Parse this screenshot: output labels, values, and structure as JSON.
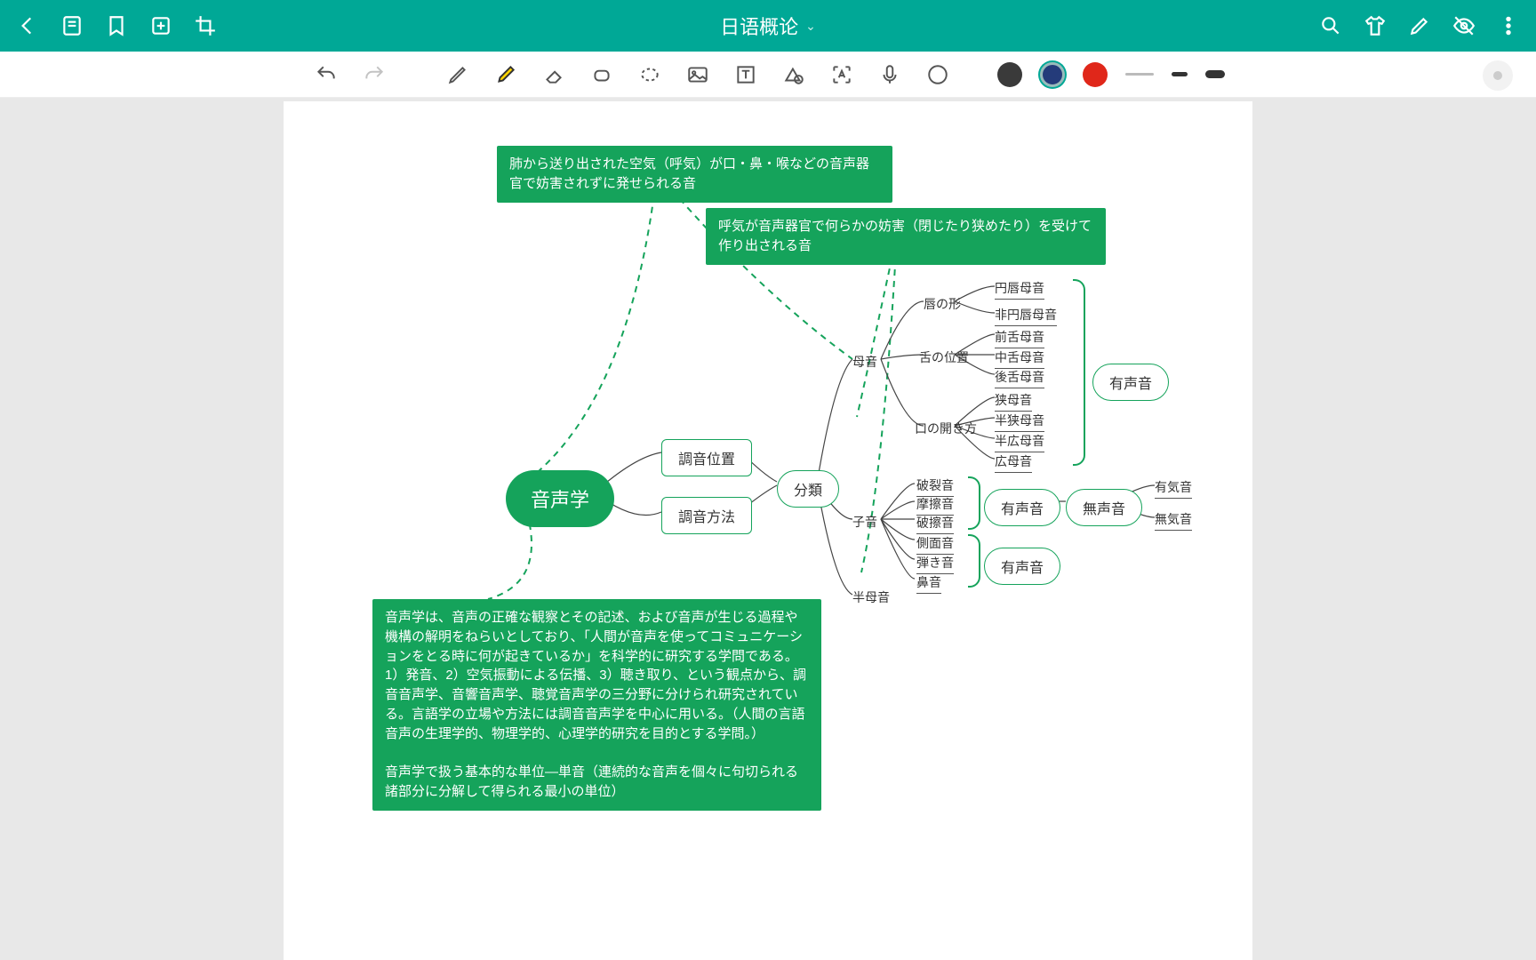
{
  "header": {
    "title": "日语概论"
  },
  "colors": {
    "accent": "#00a896",
    "green": "#15a35b",
    "red": "#e0271a",
    "navy": "#243b7a"
  },
  "icons": {
    "back": "back",
    "outline": "outline",
    "bookmark": "bookmark",
    "add-page": "add-page",
    "crop": "crop",
    "search": "search",
    "shirt": "shirt",
    "pencil": "pencil",
    "eye-off": "eye-off",
    "more": "more",
    "undo": "undo",
    "redo": "redo",
    "pen": "pen",
    "highlighter": "highlighter",
    "eraser": "eraser",
    "softeraser": "softeraser",
    "lasso": "lasso",
    "image": "image",
    "text": "text",
    "shape": "shape",
    "ocr": "ocr",
    "mic": "mic",
    "circle": "circle"
  },
  "notes": {
    "n1": "肺から送り出された空気（呼気）が口・鼻・喉などの音声器官で妨害されずに発せられる音",
    "n2": "呼気が音声器官で何らかの妨害（閉じたり狭めたり）を受けて作り出される音",
    "n3": "音声学は、音声の正確な観察とその記述、および音声が生じる過程や機構の解明をねらいとしており、「人間が音声を使ってコミュニケーションをとる時に何が起きているか」を科学的に研究する学問である。1）発音、2）空気振動による伝播、3）聴き取り、という観点から、調音音声学、音響音声学、聴覚音声学の三分野に分けられ研究されている。言語学の立場や方法には調音音声学を中心に用いる。（人間の言語音声の生理学的、物理学的、心理学的研究を目的とする学問。）\n\n音声学で扱う基本的な単位—単音（連続的な音声を個々に句切られる諸部分に分解して得られる最小の単位）"
  },
  "map": {
    "root": "音声学",
    "b1": "調音位置",
    "b2": "調音方法",
    "class": "分類",
    "vowel": "母音",
    "cons": "子音",
    "semi": "半母音",
    "lip": "唇の形",
    "lip1": "円唇母音",
    "lip2": "非円唇母音",
    "tongue": "舌の位置",
    "t1": "前舌母音",
    "t2": "中舌母音",
    "t3": "後舌母音",
    "open": "口の開き方",
    "o1": "狭母音",
    "o2": "半狭母音",
    "o3": "半広母音",
    "o4": "広母音",
    "voiced": "有声音",
    "c1": "破裂音",
    "c2": "摩擦音",
    "c3": "破擦音",
    "c4": "側面音",
    "c5": "弾き音",
    "c6": "鼻音",
    "voiced2": "有声音",
    "voiceless": "無声音",
    "asp": "有気音",
    "unasp": "無気音",
    "voiced3": "有声音"
  }
}
